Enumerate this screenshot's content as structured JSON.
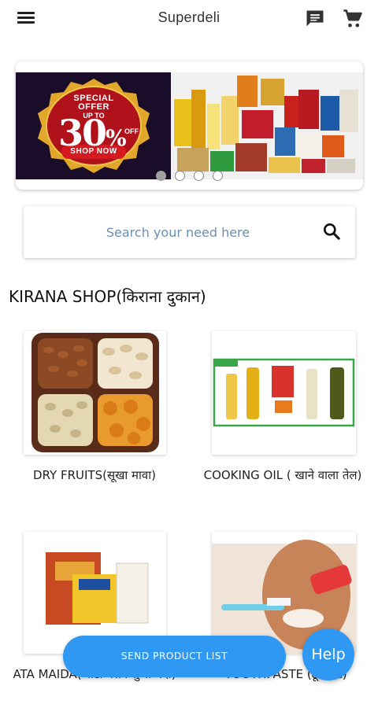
{
  "app": {
    "title": "Superdeli",
    "menu_icon": "menu-icon",
    "chat_icon": "chat-icon",
    "cart_icon": "cart-icon"
  },
  "banner": {
    "offer_line1": "SPECIAL",
    "offer_line1b": "OFFER",
    "offer_line2": "UP TO",
    "offer_value": "30",
    "offer_percent": "%",
    "offer_off": "OFF",
    "offer_cta": "SHOP NOW",
    "slide_count": 4,
    "active_slide": 1
  },
  "search": {
    "placeholder": "Search your need here",
    "icon": "search-icon"
  },
  "section": {
    "title": "KIRANA SHOP(किराना दुकान)"
  },
  "categories": [
    {
      "label": "DRY FRUITS(सूखा मावा)"
    },
    {
      "label": "COOKING OIL ( खाने वाला तेल)"
    },
    {
      "label": "ATA MAIDA(आटा बेसन सुजी मैदा)"
    },
    {
      "label": "TOOTHPASTE (टूथपेस्ट)"
    }
  ],
  "actions": {
    "send_label": "SEND PRODUCT LIST",
    "help_label": "Help"
  },
  "colors": {
    "accent": "#2e98f3",
    "offer_red": "#b0121b",
    "offer_gold": "#e0a72a",
    "placeholder": "#6b8fb3"
  }
}
